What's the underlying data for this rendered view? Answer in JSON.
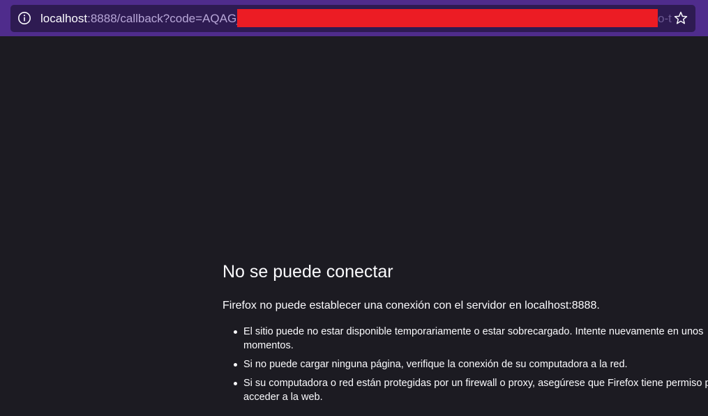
{
  "address_bar": {
    "host": "localhost",
    "rest": ":8888/callback?code=AQAG_",
    "tail": "o-t",
    "info_icon": "info-icon",
    "bookmark_icon": "star-icon"
  },
  "error_page": {
    "title": "No se puede conectar",
    "description": "Firefox no puede establecer una conexión con el servidor en localhost:8888.",
    "reasons": [
      {
        "line1": "El sitio puede no estar disponible temporariamente o estar sobrecargado. Intente nuevamente en unos",
        "line2": "momentos."
      },
      {
        "line1": "Si no puede cargar ninguna página, verifique la conexión de su computadora a la red.",
        "line2": ""
      },
      {
        "line1": "Si su computadora o red están protegidas por un firewall o proxy, asegúrese que Firefox tiene permiso para",
        "line2": "acceder a la web."
      }
    ]
  },
  "colors": {
    "toolbar": "#4f2c8c",
    "urlbar": "#2e1b52",
    "page_background": "#1c1b22",
    "redaction": "#ec1c24",
    "text": "#fbfbfe"
  }
}
